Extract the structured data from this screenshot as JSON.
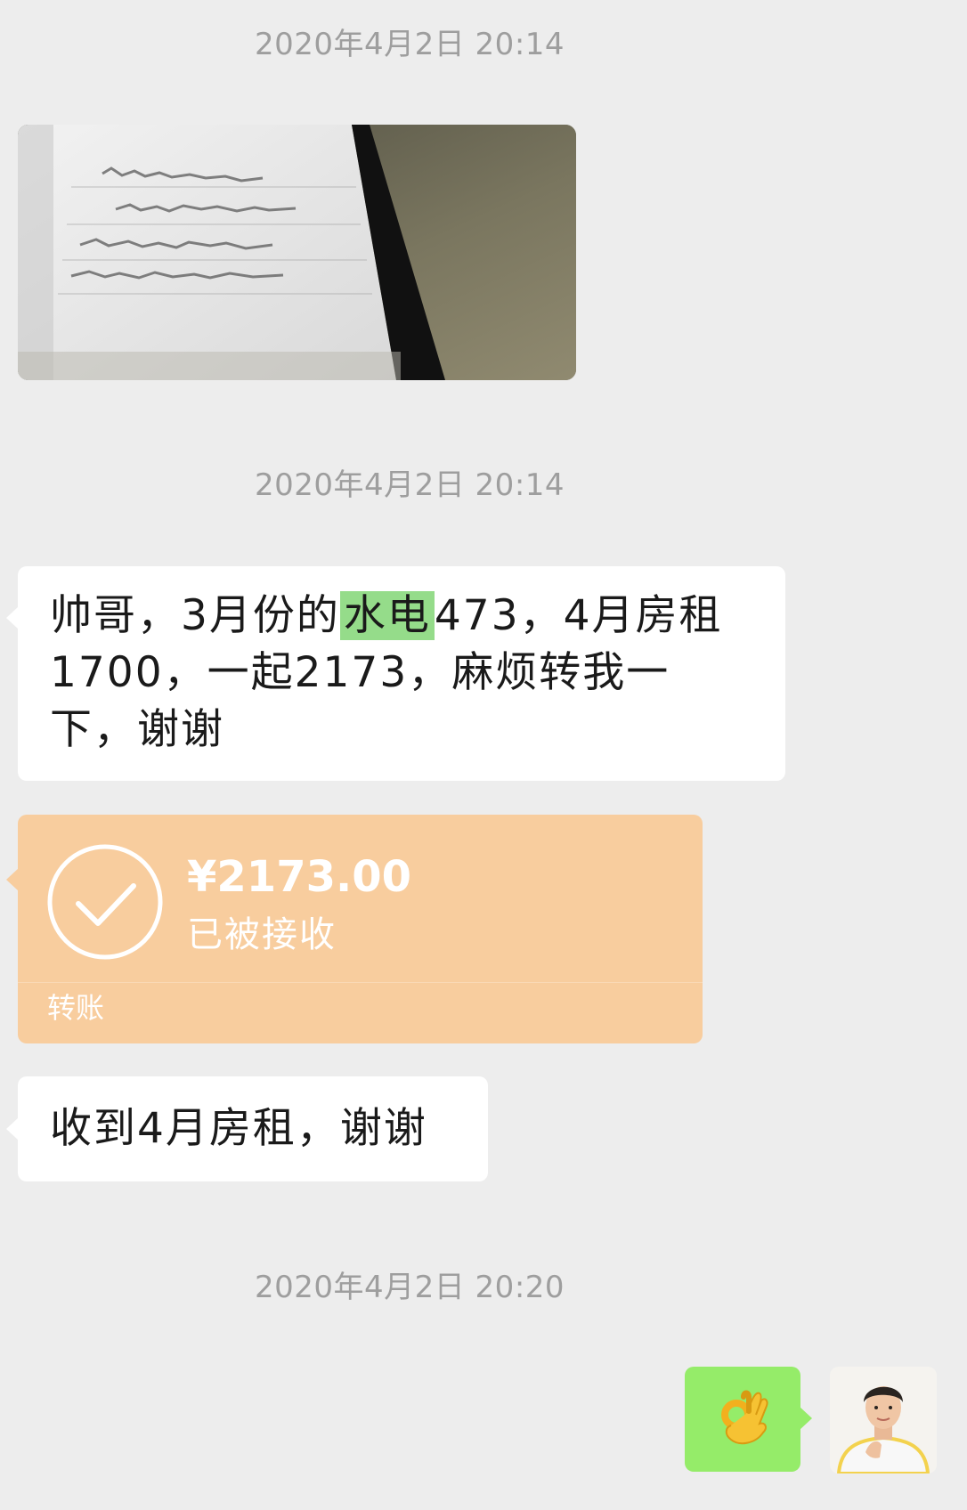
{
  "timestamps": [
    "2020年4月2日 20:14",
    "2020年4月2日 20:14",
    "2020年4月2日 20:20"
  ],
  "messages": {
    "msg1_before": "帅哥，3月份的",
    "msg1_highlight": "水电",
    "msg1_after": "473，4月房租1700，一起2173，麻烦转我一下，谢谢",
    "msg2": "收到4月房租，谢谢"
  },
  "transfer": {
    "amount": "¥2173.00",
    "status": "已被接收",
    "label": "转账"
  },
  "colors": {
    "background": "#ededed",
    "incoming_bubble": "#ffffff",
    "outgoing_bubble": "#95ec69",
    "transfer_card": "#f8cd9e",
    "highlight": "#95dc8a",
    "timestamp_text": "#9e9e9e"
  },
  "icons": {
    "check": "check-circle-icon",
    "ok_hand": "ok-hand-emoji"
  }
}
